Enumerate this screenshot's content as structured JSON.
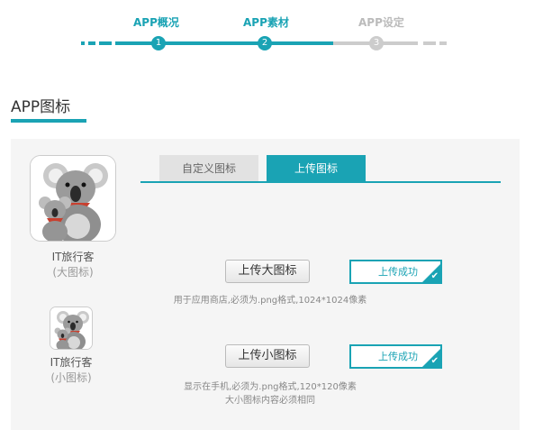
{
  "stepper": {
    "steps": [
      {
        "number": "1",
        "label": "APP概况"
      },
      {
        "number": "2",
        "label": "APP素材"
      },
      {
        "number": "3",
        "label": "APP设定"
      }
    ],
    "active_color": "#1aa3b4",
    "inactive_color": "#cccccc"
  },
  "section": {
    "title": "APP图标"
  },
  "tabs": [
    {
      "label": "自定义图标",
      "active": false
    },
    {
      "label": "上传图标",
      "active": true
    }
  ],
  "icons": {
    "big": {
      "name": "IT旅行客",
      "caption": "(大图标)",
      "image": "koala-plush-icon"
    },
    "small": {
      "name": "IT旅行客",
      "caption": "(小图标)",
      "image": "koala-plush-icon"
    }
  },
  "upload": {
    "big": {
      "button_label": "上传大图标",
      "status": "上传成功",
      "hint_lines": [
        "用于应用商店,必须为.png格式,1024*1024像素"
      ]
    },
    "small": {
      "button_label": "上传小图标",
      "status": "上传成功",
      "hint_lines": [
        "显示在手机,必须为.png格式,120*120像素",
        "大小图标内容必须相同"
      ]
    }
  },
  "colors": {
    "accent": "#1aa3b4",
    "panel_bg": "#f5f5f5"
  }
}
